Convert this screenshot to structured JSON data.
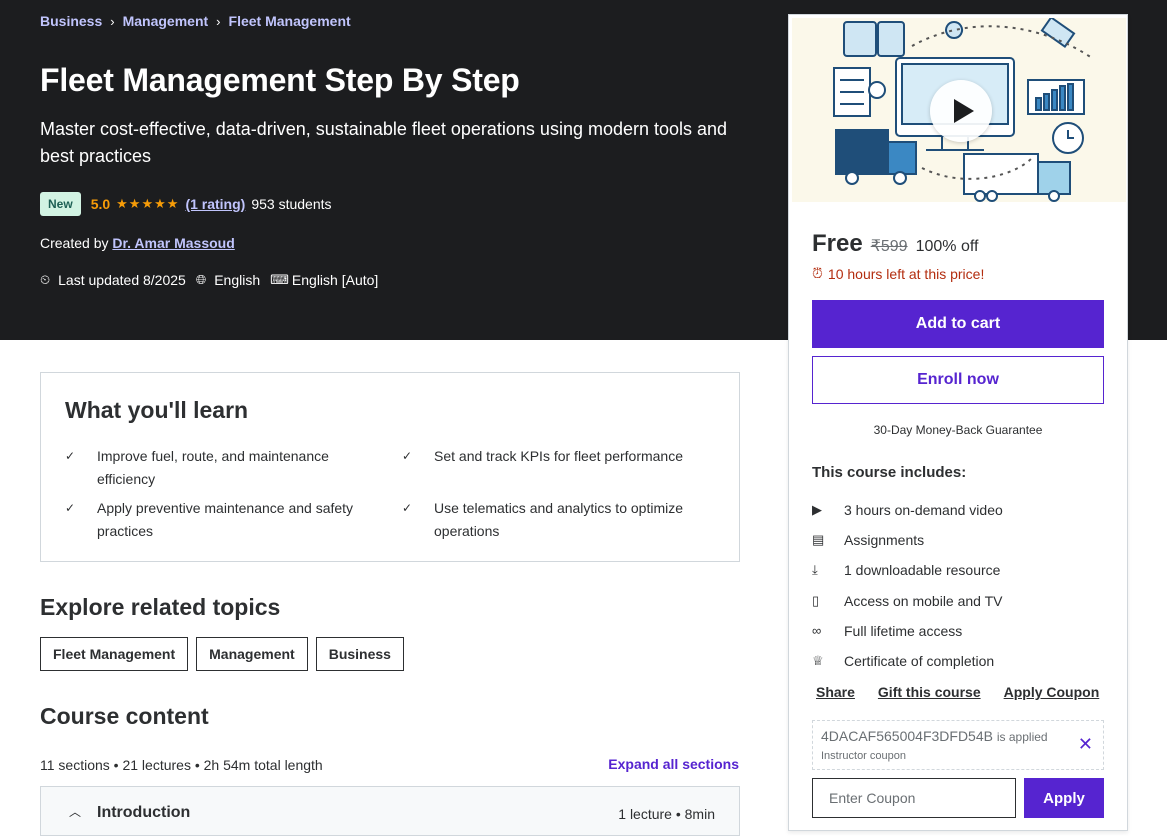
{
  "breadcrumb": [
    "Business",
    "Management",
    "Fleet Management"
  ],
  "course": {
    "title": "Fleet Management Step By Step",
    "subtitle": "Master cost-effective, data-driven, sustainable fleet operations using modern tools and best practices",
    "badge": "New",
    "rating": "5.0",
    "stars": "★★★★★",
    "rating_link": "(1 rating)",
    "students": "953 students",
    "created_label": "Created by",
    "instructor": "Dr. Amar Massoud",
    "last_updated": "Last updated 8/2025",
    "language": "English",
    "captions": "English [Auto]"
  },
  "sidebar": {
    "price": "Free",
    "original_price": "₹599",
    "discount": "100% off",
    "time_left": "10 hours left at this price!",
    "add_to_cart": "Add to cart",
    "enroll_now": "Enroll now",
    "guarantee": "30-Day Money-Back Guarantee",
    "includes_title": "This course includes:",
    "includes": [
      {
        "icon": "video-icon",
        "label": "3 hours on-demand video"
      },
      {
        "icon": "assignment-icon",
        "label": "Assignments"
      },
      {
        "icon": "download-file-icon",
        "label": "1 downloadable resource"
      },
      {
        "icon": "mobile-icon",
        "label": "Access on mobile and TV"
      },
      {
        "icon": "infinity-icon",
        "label": "Full lifetime access"
      },
      {
        "icon": "trophy-icon",
        "label": "Certificate of completion"
      }
    ],
    "links": [
      "Share",
      "Gift this course",
      "Apply Coupon"
    ],
    "coupon_code": "4DACAF565004F3DFD54B",
    "coupon_applied": "is applied",
    "coupon_type": "Instructor coupon",
    "coupon_placeholder": "Enter Coupon",
    "apply": "Apply"
  },
  "learn": {
    "title": "What you'll learn",
    "items": [
      "Improve fuel, route, and maintenance efficiency",
      "Set and track KPIs for fleet performance",
      "Apply preventive maintenance and safety practices",
      "Use telematics and analytics to optimize operations"
    ]
  },
  "related": {
    "title": "Explore related topics",
    "topics": [
      "Fleet Management",
      "Management",
      "Business"
    ]
  },
  "content": {
    "title": "Course content",
    "stats": "11 sections • 21 lectures • 2h 54m total length",
    "expand": "Expand all sections",
    "first_section": "Introduction",
    "first_section_meta": "1 lecture • 8min"
  },
  "colors": {
    "accent": "#5624d0",
    "hero_bg": "#1c1d1f",
    "star": "#f69c08",
    "link": "#c0c4fc",
    "warning": "#b32d0f"
  }
}
